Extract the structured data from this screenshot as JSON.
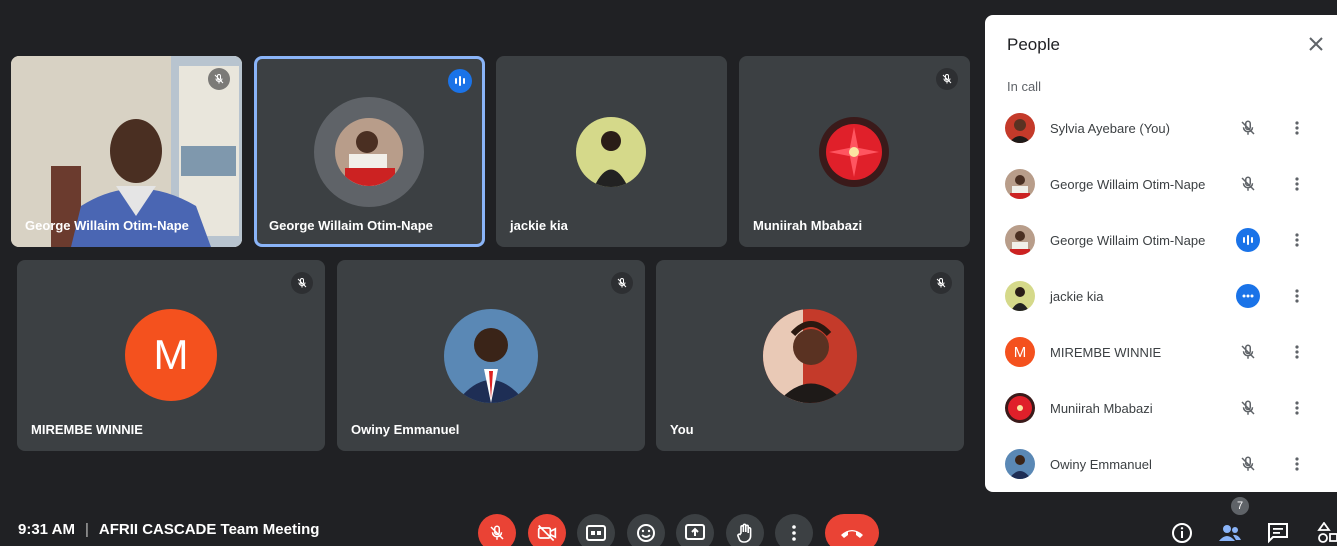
{
  "tiles": [
    {
      "name": "George Willaim Otim-Nape"
    },
    {
      "name": "George Willaim Otim-Nape"
    },
    {
      "name": "jackie kia"
    },
    {
      "name": "Muniirah Mbabazi"
    },
    {
      "name": "MIREMBE WINNIE",
      "initial": "M"
    },
    {
      "name": "Owiny Emmanuel"
    },
    {
      "name": "You"
    }
  ],
  "meeting": {
    "time": "9:31 AM",
    "separator": "|",
    "title": "AFRII CASCADE Team Meeting"
  },
  "controls": {
    "participant_count": "7"
  },
  "people_panel": {
    "title": "People",
    "section": "In call",
    "people": [
      {
        "name": "Sylvia Ayebare (You)",
        "status": "muted"
      },
      {
        "name": "George Willaim Otim-Nape",
        "status": "muted"
      },
      {
        "name": "George Willaim Otim-Nape",
        "status": "speaking"
      },
      {
        "name": "jackie kia",
        "status": "connecting"
      },
      {
        "name": "MIREMBE WINNIE",
        "status": "muted",
        "initial": "M"
      },
      {
        "name": "Muniirah Mbabazi",
        "status": "muted"
      },
      {
        "name": "Owiny Emmanuel",
        "status": "muted"
      }
    ]
  },
  "colors": {
    "background": "#202124",
    "tile": "#3c4043",
    "accent_blue": "#1a73e8",
    "active_border": "#8ab4f8",
    "danger_red": "#ea4335",
    "initial_avatar": "#f4511e"
  }
}
